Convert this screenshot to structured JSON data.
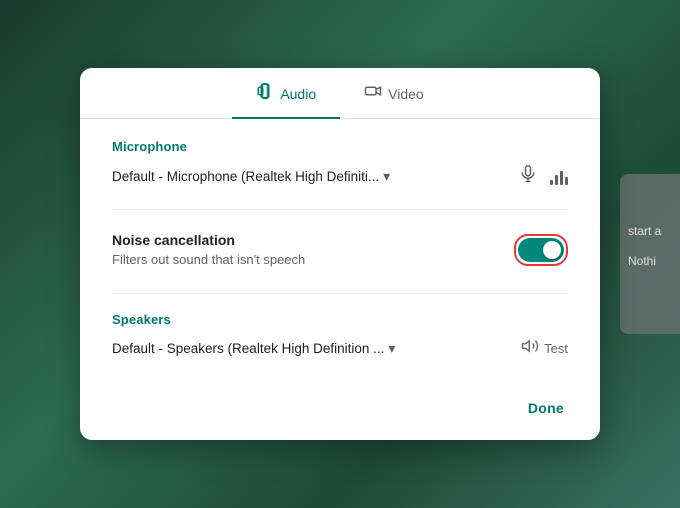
{
  "background": {
    "color": "#2d6b50"
  },
  "sidebar": {
    "start_label": "start a",
    "nothi_label": "Nothi"
  },
  "dialog": {
    "tabs": [
      {
        "id": "audio",
        "label": "Audio",
        "icon": "🔊",
        "active": true
      },
      {
        "id": "video",
        "label": "Video",
        "icon": "📷",
        "active": false
      }
    ],
    "microphone": {
      "section_label": "Microphone",
      "device_name": "Default - Microphone (Realtek High Definiti...",
      "chevron": "▾"
    },
    "noise_cancellation": {
      "title": "Noise cancellation",
      "description": "Filters out sound that isn't speech",
      "toggle_on": true
    },
    "speakers": {
      "section_label": "Speakers",
      "device_name": "Default - Speakers (Realtek High Definition ...",
      "chevron": "▾",
      "test_label": "Test"
    },
    "footer": {
      "done_label": "Done"
    }
  }
}
